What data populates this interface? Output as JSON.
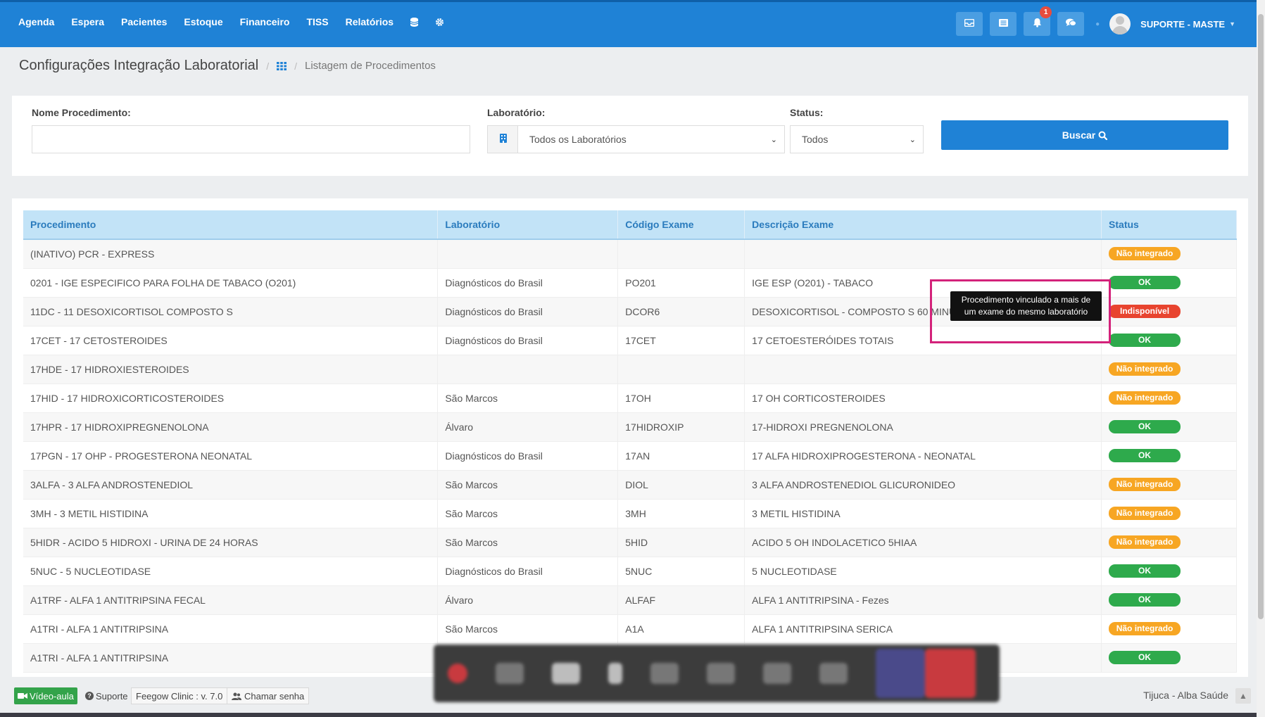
{
  "nav": {
    "items": [
      "Agenda",
      "Espera",
      "Pacientes",
      "Estoque",
      "Financeiro",
      "TISS",
      "Relatórios"
    ],
    "icons": [
      "database-icon",
      "gear-icon"
    ]
  },
  "topbar": {
    "notification_count": "1",
    "user_name": "SUPORTE - MASTE"
  },
  "breadcrumb": {
    "title": "Configurações Integração Laboratorial",
    "current": "Listagem de Procedimentos"
  },
  "filters": {
    "nome_label": "Nome Procedimento:",
    "nome_value": "",
    "lab_label": "Laboratório:",
    "lab_value": "Todos os Laboratórios",
    "status_label": "Status:",
    "status_value": "Todos",
    "buscar_label": "Buscar"
  },
  "table": {
    "headers": [
      "Procedimento",
      "Laboratório",
      "Código Exame",
      "Descrição Exame",
      "Status"
    ],
    "rows": [
      {
        "proc": "(INATIVO) PCR - EXPRESS",
        "lab": "",
        "code": "",
        "desc": "",
        "status": "Não integrado",
        "kind": "ni"
      },
      {
        "proc": "0201 - IGE ESPECIFICO PARA FOLHA DE TABACO (O201)",
        "lab": "Diagnósticos do Brasil",
        "code": "PO201",
        "desc": "IGE ESP (O201) - TABACO",
        "status": "OK",
        "kind": "ok"
      },
      {
        "proc": "11DC - 11 DESOXICORTISOL COMPOSTO S",
        "lab": "Diagnósticos do Brasil",
        "code": "DCOR6",
        "desc": "DESOXICORTISOL - COMPOSTO S 60 MINUTOS",
        "status": "Indisponível",
        "kind": "ind"
      },
      {
        "proc": "17CET - 17 CETOSTEROIDES",
        "lab": "Diagnósticos do Brasil",
        "code": "17CET",
        "desc": "17 CETOESTERÓIDES TOTAIS",
        "status": "OK",
        "kind": "ok"
      },
      {
        "proc": "17HDE - 17 HIDROXIESTEROIDES",
        "lab": "",
        "code": "",
        "desc": "",
        "status": "Não integrado",
        "kind": "ni"
      },
      {
        "proc": "17HID - 17 HIDROXICORTICOSTEROIDES",
        "lab": "São Marcos",
        "code": "17OH",
        "desc": "17 OH CORTICOSTEROIDES",
        "status": "Não integrado",
        "kind": "ni"
      },
      {
        "proc": "17HPR - 17 HIDROXIPREGNENOLONA",
        "lab": "Álvaro",
        "code": "17HIDROXIP",
        "desc": "17-HIDROXI PREGNENOLONA",
        "status": "OK",
        "kind": "ok"
      },
      {
        "proc": "17PGN - 17 OHP - PROGESTERONA NEONATAL",
        "lab": "Diagnósticos do Brasil",
        "code": "17AN",
        "desc": "17 ALFA HIDROXIPROGESTERONA - NEONATAL",
        "status": "OK",
        "kind": "ok"
      },
      {
        "proc": "3ALFA - 3 ALFA ANDROSTENEDIOL",
        "lab": "São Marcos",
        "code": "DIOL",
        "desc": "3 ALFA ANDROSTENEDIOL GLICURONIDEO",
        "status": "Não integrado",
        "kind": "ni"
      },
      {
        "proc": "3MH - 3 METIL HISTIDINA",
        "lab": "São Marcos",
        "code": "3MH",
        "desc": "3 METIL HISTIDINA",
        "status": "Não integrado",
        "kind": "ni"
      },
      {
        "proc": "5HIDR - ACIDO 5 HIDROXI - URINA DE 24 HORAS",
        "lab": "São Marcos",
        "code": "5HID",
        "desc": "ACIDO 5 OH INDOLACETICO 5HIAA",
        "status": "Não integrado",
        "kind": "ni"
      },
      {
        "proc": "5NUC - 5 NUCLEOTIDASE",
        "lab": "Diagnósticos do Brasil",
        "code": "5NUC",
        "desc": "5 NUCLEOTIDASE",
        "status": "OK",
        "kind": "ok"
      },
      {
        "proc": "A1TRF - ALFA 1 ANTITRIPSINA FECAL",
        "lab": "Álvaro",
        "code": "ALFAF",
        "desc": "ALFA 1 ANTITRIPSINA - Fezes",
        "status": "OK",
        "kind": "ok"
      },
      {
        "proc": "A1TRI - ALFA 1 ANTITRIPSINA",
        "lab": "São Marcos",
        "code": "A1A",
        "desc": "ALFA 1 ANTITRIPSINA SERICA",
        "status": "Não integrado",
        "kind": "ni"
      },
      {
        "proc": "A1TRI - ALFA 1 ANTITRIPSINA",
        "lab": "",
        "code": "",
        "desc": "",
        "status": "OK",
        "kind": "ok"
      }
    ]
  },
  "tooltip": "Procedimento vinculado a mais de um exame do mesmo laboratório",
  "footer": {
    "video": "Vídeo-aula",
    "support": "Suporte",
    "version": "Feegow Clinic : v. 7.0",
    "call": "Chamar senha",
    "clinic": "Tijuca - Alba Saúde"
  },
  "colors": {
    "primary": "#1f82d6",
    "header_bg": "#c2e3f7",
    "ok": "#2eaa4c",
    "not_integrated": "#f7a623",
    "unavailable": "#e8442f",
    "highlight": "#d3227a"
  }
}
